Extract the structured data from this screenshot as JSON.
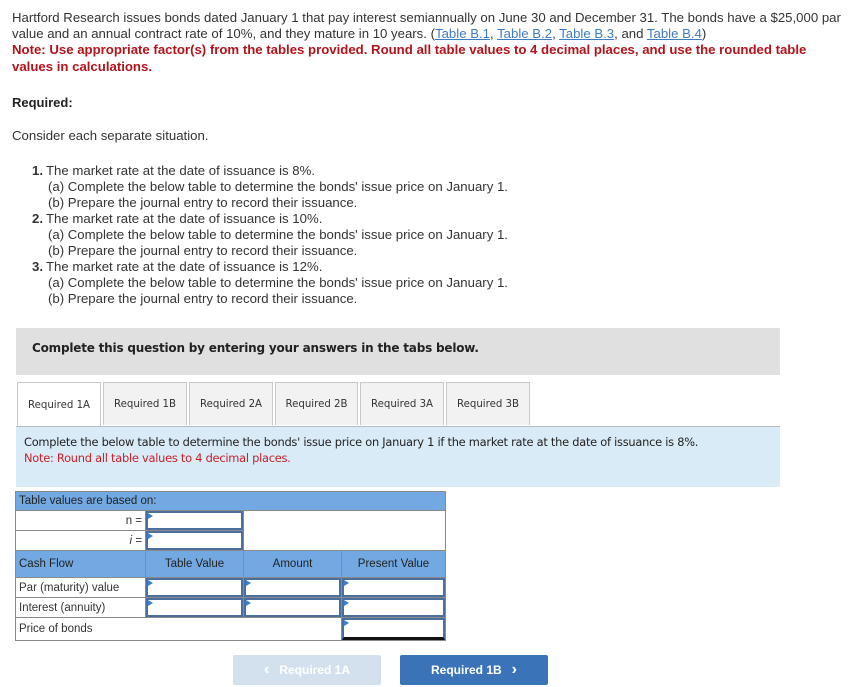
{
  "problem": {
    "intro_part1": "Hartford Research issues bonds dated January 1 that pay interest semiannually on June 30 and December 31. The bonds have a $25,000 par value and an annual contract rate of 10%, and they mature in 10 years. (",
    "links": [
      "Table B.1",
      "Table B.2",
      "Table B.3",
      "Table B.4"
    ],
    "sep1": ", ",
    "sep2": ", ",
    "sep3": ", and ",
    "intro_close": ")",
    "note": "Note: Use appropriate factor(s) from the tables provided. Round all table values to 4 decimal places, and use the rounded table values in calculations."
  },
  "required_heading": "Required:",
  "consider": "Consider each separate situation.",
  "situations": [
    {
      "num": "1.",
      "text": "The market rate at the date of issuance is 8%.",
      "a": "(a) Complete the below table to determine the bonds' issue price on January 1.",
      "b": "(b) Prepare the journal entry to record their issuance."
    },
    {
      "num": "2.",
      "text": "The market rate at the date of issuance is 10%.",
      "a": "(a) Complete the below table to determine the bonds' issue price on January 1.",
      "b": "(b) Prepare the journal entry to record their issuance."
    },
    {
      "num": "3.",
      "text": "The market rate at the date of issuance is 12%.",
      "a": "(a) Complete the below table to determine the bonds' issue price on January 1.",
      "b": "(b) Prepare the journal entry to record their issuance."
    }
  ],
  "instruction_box": "Complete this question by entering your answers in the tabs below.",
  "tabs": [
    {
      "label": "Required 1A",
      "active": true
    },
    {
      "label": "Required 1B",
      "active": false
    },
    {
      "label": "Required 2A",
      "active": false
    },
    {
      "label": "Required 2B",
      "active": false
    },
    {
      "label": "Required 3A",
      "active": false
    },
    {
      "label": "Required 3B",
      "active": false
    }
  ],
  "panel": {
    "text": "Complete the below table to determine the bonds' issue price on January 1 if the market rate at the date of issuance is 8%.",
    "note": "Note: Round all table values to 4 decimal places."
  },
  "pv_table": {
    "based_on_header": "Table values are based on:",
    "n_label": "n =",
    "i_label": "i =",
    "n_value": "",
    "i_value": "",
    "columns": [
      "Cash Flow",
      "Table Value",
      "Amount",
      "Present Value"
    ],
    "rows": [
      {
        "label": "Par (maturity) value",
        "table_value": "",
        "amount": "",
        "present_value": ""
      },
      {
        "label": "Interest (annuity)",
        "table_value": "",
        "amount": "",
        "present_value": ""
      }
    ],
    "total_label": "Price of bonds",
    "total_value": ""
  },
  "nav": {
    "prev_label": "Required 1A",
    "next_label": "Required 1B",
    "prev_icon": "‹",
    "next_icon": "›"
  },
  "colors": {
    "note_red": "#b3131b",
    "link_blue": "#3f7bbf",
    "header_blue": "#72a9e2",
    "panel_bg": "#daebf8",
    "next_button": "#3a73b8",
    "prev_button_disabled": "#d3e1ef"
  }
}
